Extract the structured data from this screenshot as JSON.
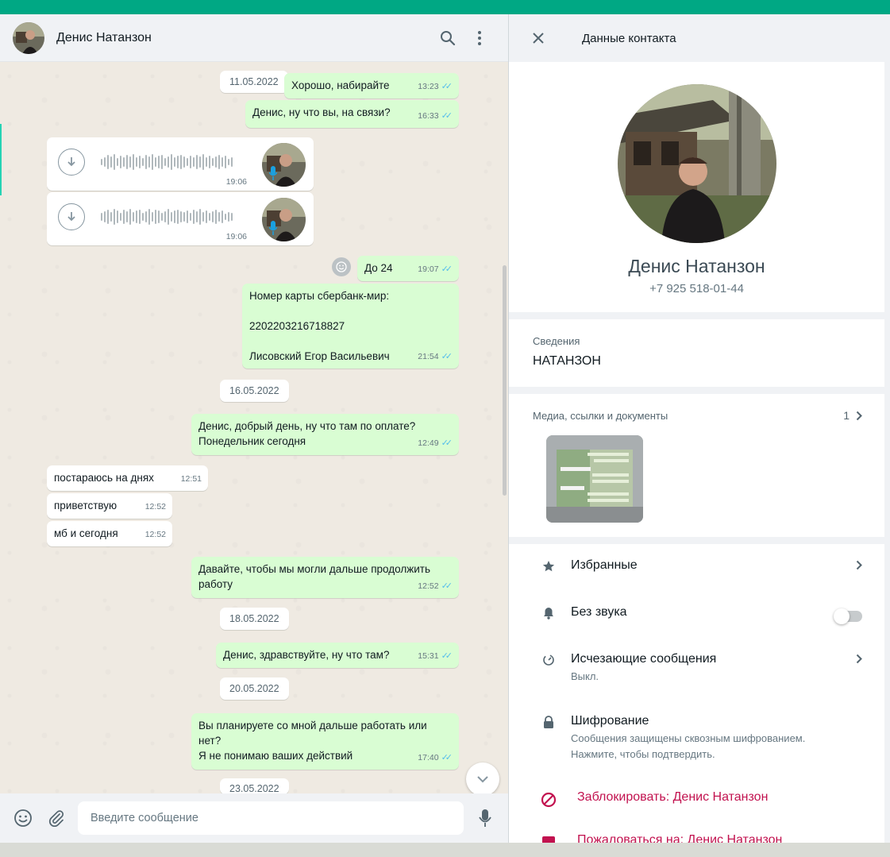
{
  "chat": {
    "contact_name": "Денис Натанзон",
    "composer_placeholder": "Введите сообщение",
    "dates": [
      "11.05.2022",
      "16.05.2022",
      "18.05.2022",
      "20.05.2022",
      "23.05.2022"
    ],
    "messages": [
      {
        "text": "Хорошо, набирайте",
        "time": "13:23"
      },
      {
        "text": "Денис, ну что вы, на связи?",
        "time": "16:33"
      },
      {
        "text": "До 24",
        "time": "19:07"
      },
      {
        "text": "Номер карты сбербанк-мир:\n\n2202203216718827\n\nЛисовский Егор Васильевич",
        "time": "21:54"
      },
      {
        "text": "Денис, добрый день, ну что там по оплате?\nПонедельник сегодня",
        "time": "12:49"
      },
      {
        "text": "постараюсь на днях",
        "time": "12:51"
      },
      {
        "text": "приветствую",
        "time": "12:52"
      },
      {
        "text": "мб и сегодня",
        "time": "12:52"
      },
      {
        "text": "Давайте, чтобы мы могли дальше продолжить\nработу",
        "time": "12:52"
      },
      {
        "text": "Денис, здравствуйте, ну что там?",
        "time": "15:31"
      },
      {
        "text": "Вы планируете со мной дальше работать или\nнет?\nЯ не понимаю ваших действий",
        "time": "17:40"
      }
    ],
    "voice_messages": [
      {
        "time": "19:06"
      },
      {
        "time": "19:06"
      }
    ],
    "colors": {
      "outgoing": "#d9fdd3",
      "incoming": "#ffffff",
      "accent": "#00a884",
      "ticks": "#53bdeb"
    }
  },
  "contact": {
    "header_title": "Данные контакта",
    "name": "Денис Натанзон",
    "phone": "+7 925 518-01-44",
    "about_label": "Сведения",
    "about_value": "НАТАНЗОН",
    "media_label": "Медиа, ссылки и документы",
    "media_count": "1",
    "starred": "Избранные",
    "mute": "Без звука",
    "disappearing": "Исчезающие сообщения",
    "disappearing_sub": "Выкл.",
    "encryption": "Шифрование",
    "encryption_sub": "Сообщения защищены сквозным шифрованием.\nНажмите, чтобы подтвердить.",
    "block": "Заблокировать: Денис Натанзон",
    "report": "Пожаловаться на: Денис Натанзон",
    "danger_color": "#c2124f"
  }
}
